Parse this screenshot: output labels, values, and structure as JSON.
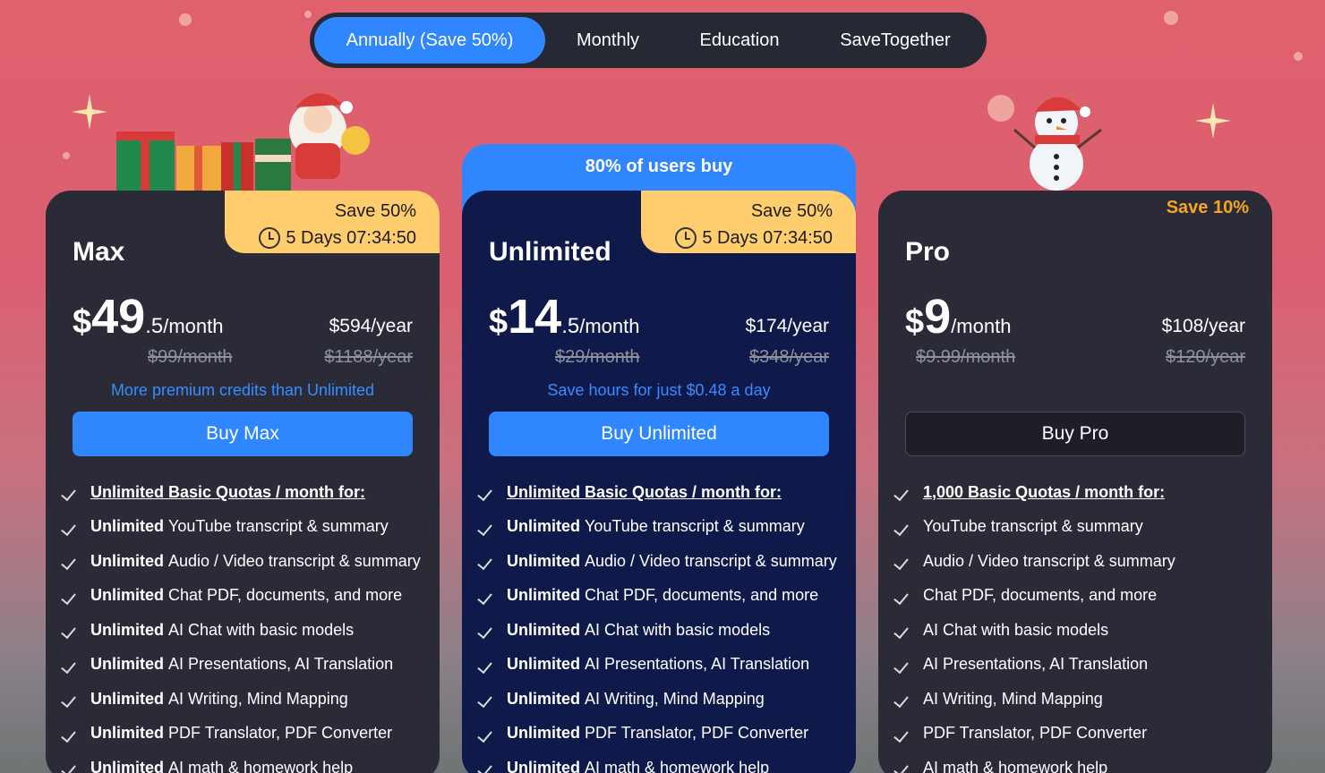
{
  "tabs": [
    {
      "label": "Annually (Save 50%)",
      "active": true
    },
    {
      "label": "Monthly"
    },
    {
      "label": "Education"
    },
    {
      "label": "SaveTogether"
    }
  ],
  "popular_label": "80% of users buy",
  "colors": {
    "accent": "#2f86ff",
    "badge": "#ffcd6e",
    "discount": "#f5a623"
  },
  "plans": [
    {
      "name": "Max",
      "badge_save": "Save 50%",
      "badge_timer": "5 Days 07:34:50",
      "price_cur": "$",
      "price_int": "49",
      "price_dec": ".5",
      "price_per": "/month",
      "year_price": "$594/year",
      "old_month": "$99/month",
      "old_year": "$1188/year",
      "tagline": "More premium credits than Unlimited",
      "buy_label": "Buy Max",
      "features": [
        {
          "bold": "",
          "text": "Unlimited Basic Quotas / month for:"
        },
        {
          "bold": "Unlimited",
          "text": "YouTube transcript & summary"
        },
        {
          "bold": "Unlimited",
          "text": "Audio / Video transcript & summary"
        },
        {
          "bold": "Unlimited",
          "text": "Chat PDF, documents, and more"
        },
        {
          "bold": "Unlimited",
          "text": "AI Chat with basic models"
        },
        {
          "bold": "Unlimited",
          "text": "AI Presentations, AI Translation"
        },
        {
          "bold": "Unlimited",
          "text": "AI Writing, Mind Mapping"
        },
        {
          "bold": "Unlimited",
          "text": "PDF Translator, PDF Converter"
        },
        {
          "bold": "Unlimited",
          "text": "AI math & homework help"
        }
      ]
    },
    {
      "name": "Unlimited",
      "badge_save": "Save 50%",
      "badge_timer": "5 Days 07:34:50",
      "price_cur": "$",
      "price_int": "14",
      "price_dec": ".5",
      "price_per": "/month",
      "year_price": "$174/year",
      "old_month": "$29/month",
      "old_year": "$348/year",
      "tagline": "Save hours for just $0.48 a day",
      "buy_label": "Buy Unlimited",
      "features": [
        {
          "bold": "",
          "text": "Unlimited Basic Quotas / month for:"
        },
        {
          "bold": "Unlimited",
          "text": "YouTube transcript & summary"
        },
        {
          "bold": "Unlimited",
          "text": "Audio / Video transcript & summary"
        },
        {
          "bold": "Unlimited",
          "text": "Chat PDF, documents, and more"
        },
        {
          "bold": "Unlimited",
          "text": "AI Chat with basic models"
        },
        {
          "bold": "Unlimited",
          "text": "AI Presentations, AI Translation"
        },
        {
          "bold": "Unlimited",
          "text": "AI Writing, Mind Mapping"
        },
        {
          "bold": "Unlimited",
          "text": "PDF Translator, PDF Converter"
        },
        {
          "bold": "Unlimited",
          "text": "AI math & homework help"
        }
      ]
    },
    {
      "name": "Pro",
      "badge_save": "Save 10%",
      "price_cur": "$",
      "price_int": "9",
      "price_dec": "",
      "price_per": "/month",
      "year_price": "$108/year",
      "old_month": "$9.99/month",
      "old_year": "$120/year",
      "buy_label": "Buy Pro",
      "features": [
        {
          "bold": "",
          "text": "1,000 Basic Quotas / month for:"
        },
        {
          "bold": "",
          "text": "YouTube transcript & summary"
        },
        {
          "bold": "",
          "text": "Audio / Video transcript & summary"
        },
        {
          "bold": "",
          "text": "Chat PDF, documents, and more"
        },
        {
          "bold": "",
          "text": "AI Chat with basic models"
        },
        {
          "bold": "",
          "text": "AI Presentations, AI Translation"
        },
        {
          "bold": "",
          "text": "AI Writing, Mind Mapping"
        },
        {
          "bold": "",
          "text": "PDF Translator, PDF Converter"
        },
        {
          "bold": "",
          "text": "AI math & homework help"
        }
      ]
    }
  ]
}
